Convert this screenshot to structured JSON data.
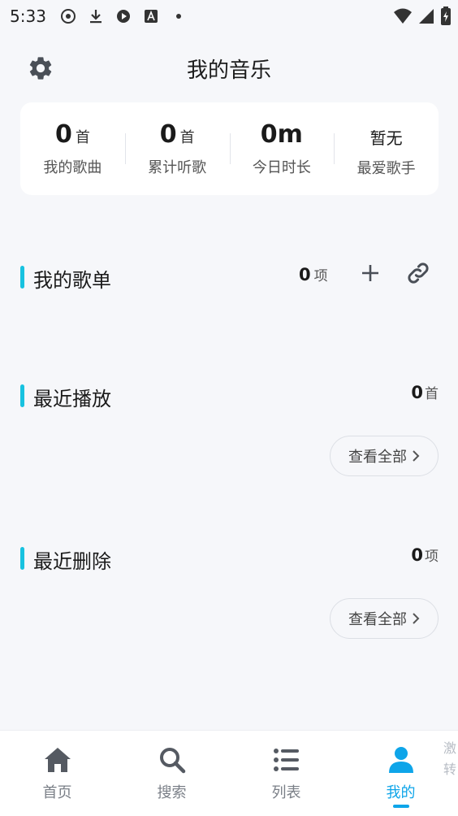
{
  "status_bar": {
    "time": "5:33"
  },
  "header": {
    "title": "我的音乐"
  },
  "stats": [
    {
      "value": "0",
      "unit": "首",
      "label": "我的歌曲"
    },
    {
      "value": "0",
      "unit": "首",
      "label": "累计听歌"
    },
    {
      "value": "0m",
      "unit": "",
      "label": "今日时长"
    },
    {
      "value": "暂无",
      "unit": "",
      "label": "最爱歌手"
    }
  ],
  "playlists": {
    "title": "我的歌单",
    "count": "0",
    "count_unit": "项"
  },
  "recent_played": {
    "title": "最近播放",
    "count": "0",
    "count_unit": "首",
    "view_all": "查看全部"
  },
  "recent_deleted": {
    "title": "最近删除",
    "count": "0",
    "count_unit": "项",
    "view_all": "查看全部"
  },
  "bottom_nav": [
    {
      "label": "首页",
      "icon": "home-icon"
    },
    {
      "label": "搜索",
      "icon": "search-icon"
    },
    {
      "label": "列表",
      "icon": "list-icon"
    },
    {
      "label": "我的",
      "icon": "user-icon",
      "active": true
    }
  ],
  "side_peek": "激转",
  "colors": {
    "accent": "#0ea5e9",
    "section_bar": "#18c2e0",
    "background": "#f6f7fa"
  }
}
